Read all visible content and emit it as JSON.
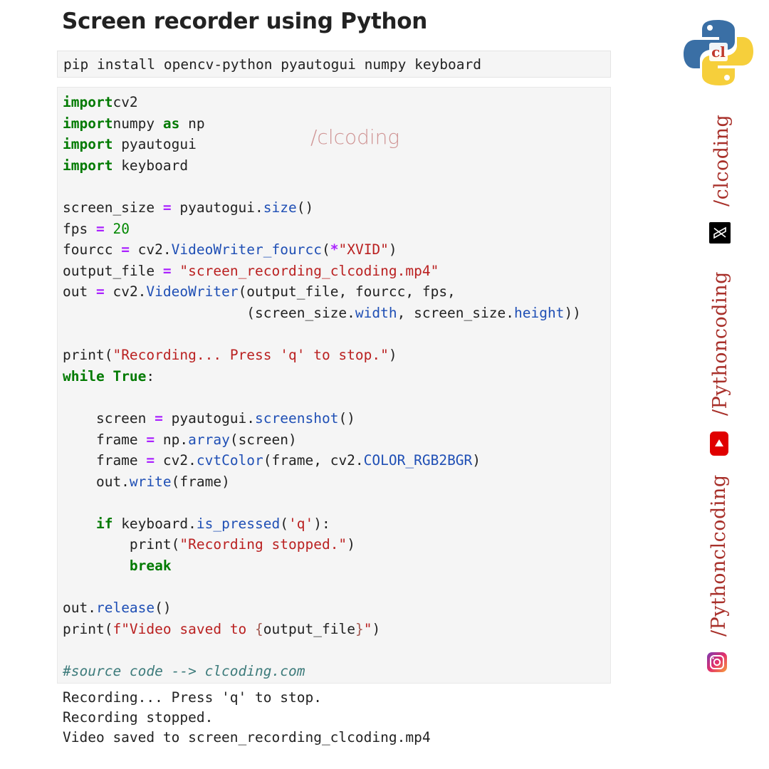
{
  "title": "Screen recorder using Python",
  "install_command": "pip install opencv-python pyautogui numpy keyboard",
  "watermark": "/clcoding",
  "code_lines": [
    [
      [
        "kw",
        "import"
      ],
      [
        "",
        "cv2"
      ]
    ],
    [
      [
        "kw",
        "import"
      ],
      [
        "",
        "numpy "
      ],
      [
        "kw",
        "as"
      ],
      [
        "",
        " np"
      ]
    ],
    [
      [
        "kw",
        "import"
      ],
      [
        "",
        " pyautogui"
      ]
    ],
    [
      [
        "kw",
        "import"
      ],
      [
        "",
        " keyboard"
      ]
    ],
    [],
    [
      [
        "",
        "screen_size "
      ],
      [
        "op",
        "="
      ],
      [
        "",
        " pyautogui."
      ],
      [
        "fn",
        "size"
      ],
      [
        "",
        "()"
      ]
    ],
    [
      [
        "",
        "fps "
      ],
      [
        "op",
        "="
      ],
      [
        "",
        " "
      ],
      [
        "num",
        "20"
      ]
    ],
    [
      [
        "",
        "fourcc "
      ],
      [
        "op",
        "="
      ],
      [
        "",
        " cv2."
      ],
      [
        "fn",
        "VideoWriter_fourcc"
      ],
      [
        "",
        "("
      ],
      [
        "op",
        "*"
      ],
      [
        "str",
        "\"XVID\""
      ],
      [
        "",
        ")"
      ]
    ],
    [
      [
        "",
        "output_file "
      ],
      [
        "op",
        "="
      ],
      [
        "",
        " "
      ],
      [
        "str",
        "\"screen_recording_clcoding.mp4\""
      ]
    ],
    [
      [
        "",
        "out "
      ],
      [
        "op",
        "="
      ],
      [
        "",
        " cv2."
      ],
      [
        "fn",
        "VideoWriter"
      ],
      [
        "",
        "(output_file, fourcc, fps,"
      ]
    ],
    [
      [
        "",
        "                      (screen_size."
      ],
      [
        "fn",
        "width"
      ],
      [
        "",
        ", screen_size."
      ],
      [
        "fn",
        "height"
      ],
      [
        "",
        "))"
      ]
    ],
    [],
    [
      [
        "",
        "print("
      ],
      [
        "str",
        "\"Recording... Press 'q' to stop.\""
      ],
      [
        "",
        ")"
      ]
    ],
    [
      [
        "kw",
        "while"
      ],
      [
        "",
        " "
      ],
      [
        "kw",
        "True"
      ],
      [
        "",
        ":"
      ]
    ],
    [],
    [
      [
        "",
        "    screen "
      ],
      [
        "op",
        "="
      ],
      [
        "",
        " pyautogui."
      ],
      [
        "fn",
        "screenshot"
      ],
      [
        "",
        "()"
      ]
    ],
    [
      [
        "",
        "    frame "
      ],
      [
        "op",
        "="
      ],
      [
        "",
        " np."
      ],
      [
        "fn",
        "array"
      ],
      [
        "",
        "(screen)"
      ]
    ],
    [
      [
        "",
        "    frame "
      ],
      [
        "op",
        "="
      ],
      [
        "",
        " cv2."
      ],
      [
        "fn",
        "cvtColor"
      ],
      [
        "",
        "(frame, cv2."
      ],
      [
        "fn",
        "COLOR_RGB2BGR"
      ],
      [
        "",
        ")"
      ]
    ],
    [
      [
        "",
        "    out."
      ],
      [
        "fn",
        "write"
      ],
      [
        "",
        "(frame)"
      ]
    ],
    [],
    [
      [
        "",
        "    "
      ],
      [
        "kw",
        "if"
      ],
      [
        "",
        " keyboard."
      ],
      [
        "fn",
        "is_pressed"
      ],
      [
        "",
        "("
      ],
      [
        "str",
        "'q'"
      ],
      [
        "",
        "):"
      ]
    ],
    [
      [
        "",
        "        print("
      ],
      [
        "str",
        "\"Recording stopped.\""
      ],
      [
        "",
        ")"
      ]
    ],
    [
      [
        "",
        "        "
      ],
      [
        "kw",
        "break"
      ]
    ],
    [],
    [
      [
        "",
        "out."
      ],
      [
        "fn",
        "release"
      ],
      [
        "",
        "()"
      ]
    ],
    [
      [
        "",
        "print("
      ],
      [
        "str",
        "f\"Video saved to "
      ],
      [
        "brace",
        "{"
      ],
      [
        "",
        "output_file"
      ],
      [
        "brace",
        "}"
      ],
      [
        "str",
        "\""
      ],
      [
        "",
        ")"
      ]
    ],
    [],
    [
      [
        "cm",
        "#source code --> clcoding.com"
      ]
    ]
  ],
  "output_lines": [
    "Recording... Press 'q' to stop.",
    "Recording stopped.",
    "Video saved to screen_recording_clcoding.mp4"
  ],
  "social": {
    "x_handle": "/clcoding",
    "youtube_handle": "/Pythoncoding",
    "instagram_handle": "/Pythonclcoding"
  },
  "colors": {
    "keyword": "#007a00",
    "operator": "#aa22ff",
    "string": "#ba2121",
    "function": "#1f4fb5",
    "comment": "#3d7b7b",
    "brand": "#a8302a"
  },
  "icons": {
    "logo": "python-clcoding-logo",
    "x": "x-logo-icon",
    "youtube": "youtube-icon",
    "instagram": "instagram-icon"
  }
}
